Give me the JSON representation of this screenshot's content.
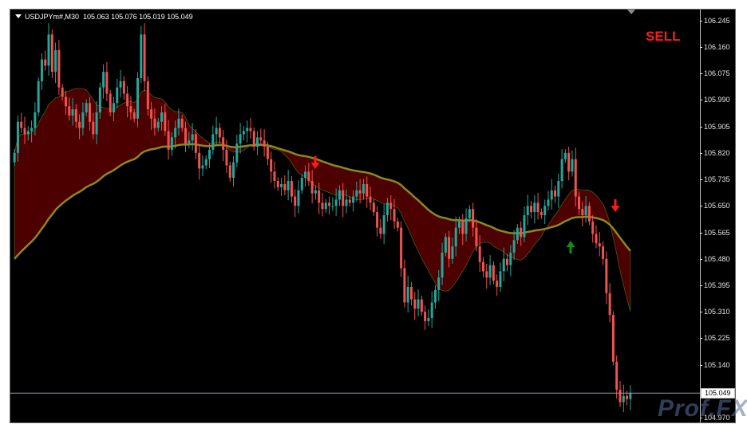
{
  "symbol": {
    "name": "USDJPYm#,M30",
    "ohlc": "105.063 105.076 105.019 105.049"
  },
  "signal_label": "SELL",
  "current_price": "105.049",
  "watermark": "Prof.FX",
  "price_axis": {
    "ticks": [
      "106.245",
      "106.160",
      "106.075",
      "105.990",
      "105.905",
      "105.820",
      "105.735",
      "105.650",
      "105.565",
      "105.480",
      "105.395",
      "105.310",
      "105.225",
      "105.140",
      "104.970"
    ]
  },
  "colors": {
    "background": "#000000",
    "bull_candle": "#26a69a",
    "bear_candle": "#ef5350",
    "fast_ma_band": "#5a0000",
    "slow_ma": "#8a8a1a",
    "sell_arrow": "#ff1a1a",
    "buy_arrow": "#138a13"
  },
  "chart_data": {
    "type": "candlestick",
    "price_min": 104.955,
    "price_max": 106.28,
    "closes": [
      105.82,
      105.92,
      105.9,
      105.88,
      105.89,
      105.9,
      105.95,
      106.05,
      106.12,
      106.1,
      106.2,
      106.08,
      106.15,
      106.03,
      106.0,
      105.97,
      105.94,
      105.96,
      105.92,
      105.9,
      105.95,
      105.98,
      105.92,
      105.88,
      105.95,
      106.03,
      106.08,
      106.01,
      105.95,
      105.98,
      106.03,
      106.05,
      106.01,
      105.97,
      105.95,
      105.93,
      106.06,
      106.2,
      106.05,
      105.96,
      105.93,
      105.9,
      105.92,
      105.95,
      105.89,
      105.83,
      105.87,
      105.9,
      105.93,
      105.9,
      105.85,
      105.86,
      105.88,
      105.82,
      105.77,
      105.78,
      105.8,
      105.83,
      105.88,
      105.9,
      105.87,
      105.83,
      105.78,
      105.74,
      105.79,
      105.85,
      105.88,
      105.89,
      105.9,
      105.89,
      105.84,
      105.87,
      105.86,
      105.84,
      105.8,
      105.76,
      105.73,
      105.71,
      105.72,
      105.7,
      105.73,
      105.68,
      105.65,
      105.7,
      105.74,
      105.76,
      105.73,
      105.69,
      105.7,
      105.66,
      105.64,
      105.66,
      105.65,
      105.65,
      105.67,
      105.7,
      105.65,
      105.67,
      105.66,
      105.68,
      105.7,
      105.69,
      105.72,
      105.68,
      105.66,
      105.63,
      105.58,
      105.56,
      105.62,
      105.66,
      105.64,
      105.6,
      105.58,
      105.45,
      105.34,
      105.39,
      105.35,
      105.32,
      105.35,
      105.31,
      105.28,
      105.29,
      105.34,
      105.38,
      105.42,
      105.5,
      105.55,
      105.48,
      105.52,
      105.58,
      105.6,
      105.56,
      105.61,
      105.64,
      105.58,
      105.52,
      105.47,
      105.44,
      105.42,
      105.46,
      105.41,
      105.39,
      105.44,
      105.48,
      105.46,
      105.5,
      105.54,
      105.58,
      105.55,
      105.62,
      105.65,
      105.63,
      105.66,
      105.63,
      105.62,
      105.65,
      105.67,
      105.7,
      105.68,
      105.73,
      105.8,
      105.82,
      105.76,
      105.8,
      105.68,
      105.64,
      105.62,
      105.65,
      105.6,
      105.56,
      105.53,
      105.52,
      105.48,
      105.37,
      105.3,
      105.15,
      105.06,
      105.02,
      105.04,
      105.03,
      105.05
    ]
  }
}
